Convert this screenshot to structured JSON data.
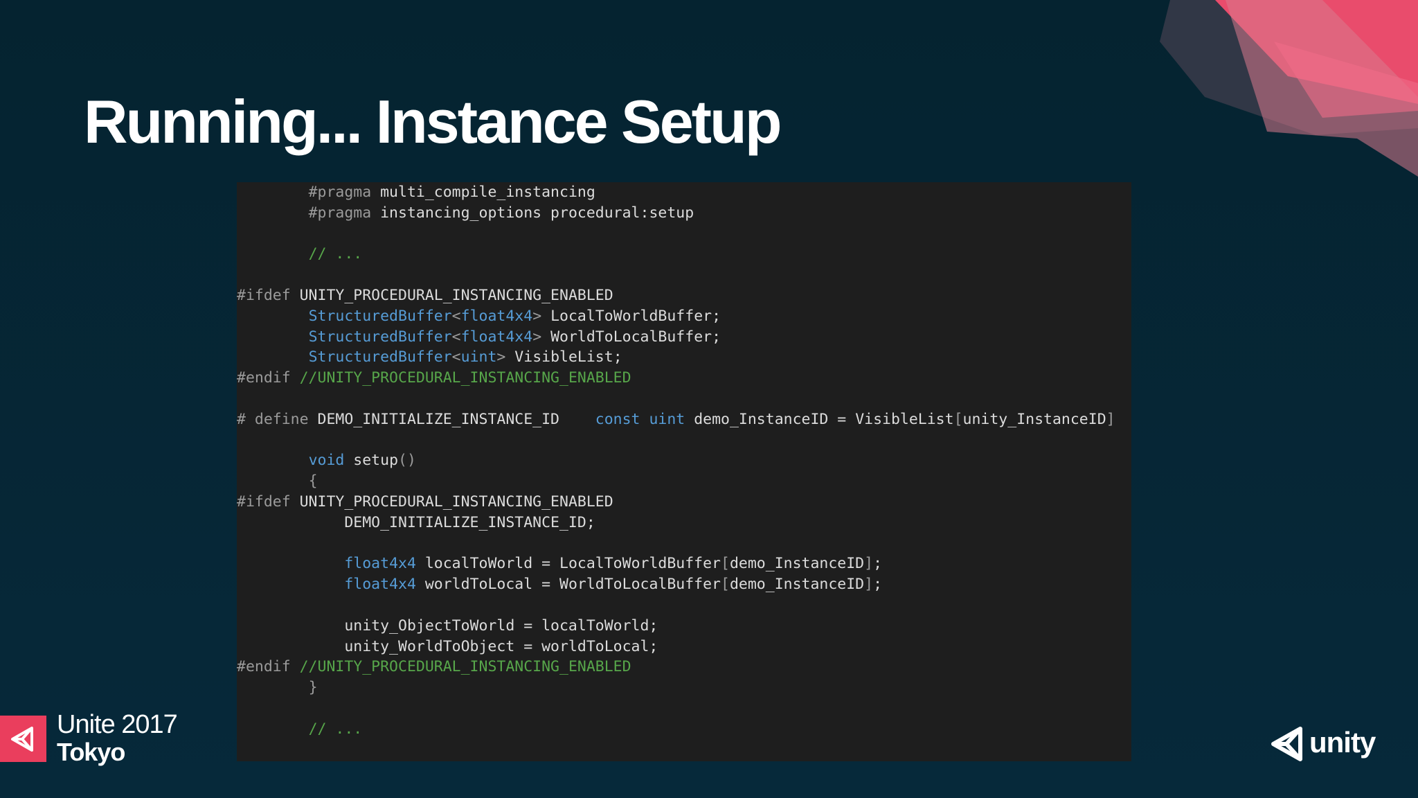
{
  "slide": {
    "title": "Running... Instance Setup"
  },
  "code": {
    "lines": [
      [
        {
          "t": "        "
        },
        {
          "t": "#pragma",
          "c": "pp"
        },
        {
          "t": " multi_compile_instancing"
        }
      ],
      [
        {
          "t": "        "
        },
        {
          "t": "#pragma",
          "c": "pp"
        },
        {
          "t": " instancing_options procedural:setup"
        }
      ],
      [],
      [
        {
          "t": "        "
        },
        {
          "t": "// ...",
          "c": "cm"
        }
      ],
      [],
      [
        {
          "t": "#ifdef",
          "c": "pp"
        },
        {
          "t": " UNITY_PROCEDURAL_INSTANCING_ENABLED"
        }
      ],
      [
        {
          "t": "        "
        },
        {
          "t": "StructuredBuffer",
          "c": "kw"
        },
        {
          "t": "<",
          "c": "pp"
        },
        {
          "t": "float4x4",
          "c": "kw"
        },
        {
          "t": ">",
          "c": "pp"
        },
        {
          "t": " LocalToWorldBuffer;"
        }
      ],
      [
        {
          "t": "        "
        },
        {
          "t": "StructuredBuffer",
          "c": "kw"
        },
        {
          "t": "<",
          "c": "pp"
        },
        {
          "t": "float4x4",
          "c": "kw"
        },
        {
          "t": ">",
          "c": "pp"
        },
        {
          "t": " WorldToLocalBuffer;"
        }
      ],
      [
        {
          "t": "        "
        },
        {
          "t": "StructuredBuffer",
          "c": "kw"
        },
        {
          "t": "<",
          "c": "pp"
        },
        {
          "t": "uint",
          "c": "kw"
        },
        {
          "t": ">",
          "c": "pp"
        },
        {
          "t": " VisibleList;"
        }
      ],
      [
        {
          "t": "#endif",
          "c": "pp"
        },
        {
          "t": " //UNITY_PROCEDURAL_INSTANCING_ENABLED",
          "c": "cm"
        }
      ],
      [],
      [
        {
          "t": "# define",
          "c": "pp"
        },
        {
          "t": " DEMO_INITIALIZE_INSTANCE_ID    "
        },
        {
          "t": "const",
          "c": "kw"
        },
        {
          "t": " "
        },
        {
          "t": "uint",
          "c": "kw"
        },
        {
          "t": " demo_InstanceID = VisibleList"
        },
        {
          "t": "[",
          "c": "pp"
        },
        {
          "t": "unity_InstanceID"
        },
        {
          "t": "]",
          "c": "pp"
        }
      ],
      [],
      [
        {
          "t": "        "
        },
        {
          "t": "void",
          "c": "kw"
        },
        {
          "t": " setup"
        },
        {
          "t": "()",
          "c": "pp"
        }
      ],
      [
        {
          "t": "        "
        },
        {
          "t": "{",
          "c": "pp"
        }
      ],
      [
        {
          "t": "#ifdef",
          "c": "pp"
        },
        {
          "t": " UNITY_PROCEDURAL_INSTANCING_ENABLED"
        }
      ],
      [
        {
          "t": "            DEMO_INITIALIZE_INSTANCE_ID;"
        }
      ],
      [],
      [
        {
          "t": "            "
        },
        {
          "t": "float4x4",
          "c": "kw"
        },
        {
          "t": " localToWorld = LocalToWorldBuffer"
        },
        {
          "t": "[",
          "c": "pp"
        },
        {
          "t": "demo_InstanceID"
        },
        {
          "t": "]",
          "c": "pp"
        },
        {
          "t": ";"
        }
      ],
      [
        {
          "t": "            "
        },
        {
          "t": "float4x4",
          "c": "kw"
        },
        {
          "t": " worldToLocal = WorldToLocalBuffer"
        },
        {
          "t": "[",
          "c": "pp"
        },
        {
          "t": "demo_InstanceID"
        },
        {
          "t": "]",
          "c": "pp"
        },
        {
          "t": ";"
        }
      ],
      [],
      [
        {
          "t": "            unity_ObjectToWorld = localToWorld;"
        }
      ],
      [
        {
          "t": "            unity_WorldToObject = worldToLocal;"
        }
      ],
      [
        {
          "t": "#endif",
          "c": "pp"
        },
        {
          "t": " //UNITY_PROCEDURAL_INSTANCING_ENABLED",
          "c": "cm"
        }
      ],
      [
        {
          "t": "        "
        },
        {
          "t": "}",
          "c": "pp"
        }
      ],
      [],
      [
        {
          "t": "        "
        },
        {
          "t": "// ...",
          "c": "cm"
        }
      ]
    ]
  },
  "footer": {
    "event_line1": "Unite 2017",
    "event_line2": "Tokyo",
    "unity_wordmark": "unity"
  },
  "icons": {
    "event_badge": "unity-cube-icon",
    "brand_mark": "unity-logo-icon",
    "decoration": "corner-shapes-decoration"
  },
  "colors": {
    "background": "#052330",
    "code_background": "#1e1e1e",
    "accent_pink": "#ea3e5d",
    "keyword_blue": "#569cd6",
    "comment_green": "#57a64a",
    "preprocessor_gray": "#9b9b9b"
  }
}
